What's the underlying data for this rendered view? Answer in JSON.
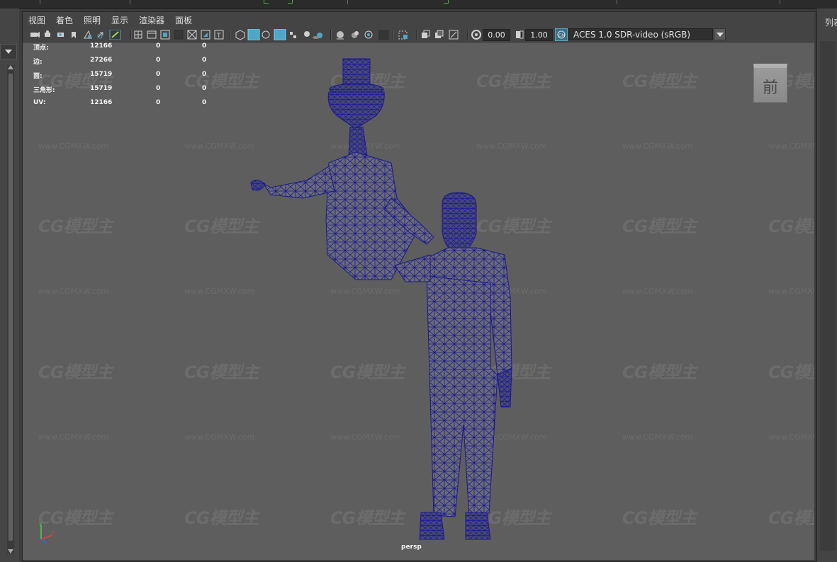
{
  "right_panel": {
    "label": "列表"
  },
  "menu": {
    "items": [
      "视图",
      "着色",
      "照明",
      "显示",
      "渲染器",
      "面板"
    ]
  },
  "toolbar": {
    "exposure": "0.00",
    "gamma": "1.00",
    "color_management": "ACES 1.0 SDR-video (sRGB)"
  },
  "hud": {
    "rows": [
      {
        "label": "顶点:",
        "v1": "12166",
        "v2": "0",
        "v3": "0"
      },
      {
        "label": "边:",
        "v1": "27266",
        "v2": "0",
        "v3": "0"
      },
      {
        "label": "面:",
        "v1": "15719",
        "v2": "0",
        "v3": "0"
      },
      {
        "label": "三角形:",
        "v1": "15719",
        "v2": "0",
        "v3": "0"
      },
      {
        "label": "UV:",
        "v1": "12166",
        "v2": "0",
        "v3": "0"
      }
    ]
  },
  "viewcube": {
    "face_label": "前"
  },
  "camera_label": "persp",
  "watermark": {
    "logo": "CG模型主",
    "url": "www.CGMXW.com"
  },
  "colors": {
    "viewport_bg": "#5e5e5e",
    "wireframe": "#1a1a8c",
    "panel": "#444444",
    "accent_toggle": "#4fa6c6"
  }
}
